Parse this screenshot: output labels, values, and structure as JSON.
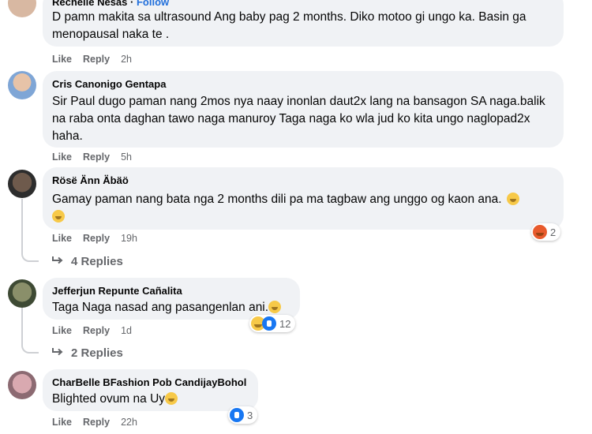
{
  "comments": [
    {
      "author": "Rechelle Nesas",
      "follow_label": "Follow",
      "text": "D pamn makita sa ultrasound Ang baby pag 2 months. Diko motoo gi ungo ka. Basin ga menopausal naka te .",
      "like_label": "Like",
      "reply_label": "Reply",
      "time": "2h"
    },
    {
      "author": "Cris Canonigo Gentapa",
      "text": "Sir Paul dugo paman nang 2mos nya naay inonlan daut2x lang na bansagon SA naga.balik na raba onta daghan tawo naga manuroy Taga naga ko wla jud ko kita ungo naglopad2x haha.",
      "like_label": "Like",
      "reply_label": "Reply",
      "time": "5h"
    },
    {
      "author": "Rösë Ä̈nn Ä̈bä̈ö",
      "text": "Gamay paman nang bata nga 2 months dili pa ma tagbaw ang unggo og kaon ana.",
      "like_label": "Like",
      "reply_label": "Reply",
      "time": "19h",
      "reaction_count": "2",
      "replies_label": "4 Replies"
    },
    {
      "author": "Jefferjun Repunte Cañalita",
      "text": "Taga Naga nasad ang pasangenlan ani.",
      "like_label": "Like",
      "reply_label": "Reply",
      "time": "1d",
      "reaction_count": "12",
      "replies_label": "2 Replies"
    },
    {
      "author": "CharBelle BFashion Pob CandijayBohol",
      "text": "Blighted ovum na Uy",
      "like_label": "Like",
      "reply_label": "Reply",
      "time": "22h",
      "reaction_count": "3"
    }
  ],
  "colors": {
    "bubble": "#f0f2f5",
    "meta_text": "#65676b",
    "link_blue": "#216fdb",
    "like_blue": "#1877f2"
  }
}
